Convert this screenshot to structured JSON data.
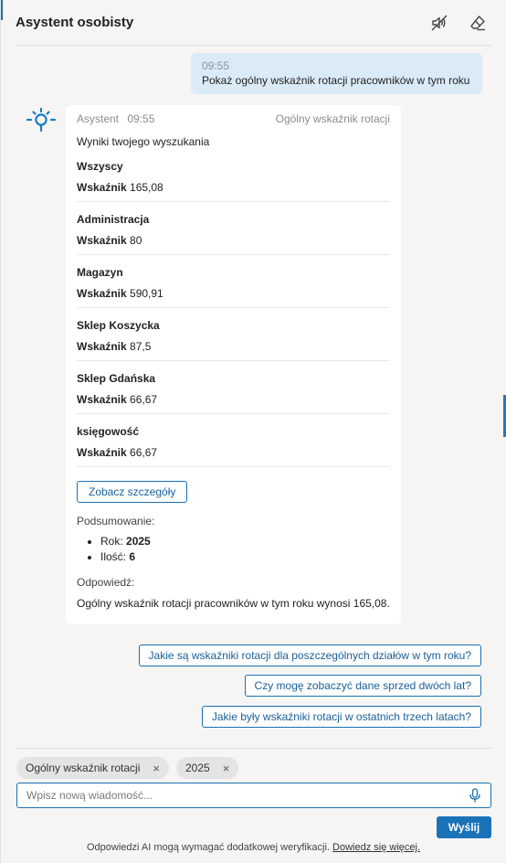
{
  "header": {
    "title": "Asystent osobisty",
    "icons": [
      "speaker-muted-icon",
      "eraser-icon"
    ]
  },
  "user_message": {
    "time": "09:55",
    "text": "Pokaż ogólny wskaźnik rotacji pracowników w tym roku"
  },
  "bot_message": {
    "author": "Asystent",
    "time": "09:55",
    "topic": "Ogólny wskaźnik rotacji",
    "results_label": "Wyniki twojego wyszukania",
    "value_label": "Wskaźnik",
    "departments": [
      {
        "name": "Wszyscy",
        "value": "165,08"
      },
      {
        "name": "Administracja",
        "value": "80"
      },
      {
        "name": "Magazyn",
        "value": "590,91"
      },
      {
        "name": "Sklep Koszycka",
        "value": "87,5"
      },
      {
        "name": "Sklep Gdańska",
        "value": "66,67"
      },
      {
        "name": "księgowość",
        "value": "66,67"
      }
    ],
    "details_button": "Zobacz szczegóły",
    "summary_label": "Podsumowanie:",
    "summary": [
      {
        "label": "Rok:",
        "value": "2025"
      },
      {
        "label": "Ilość:",
        "value": "6"
      }
    ],
    "answer_label": "Odpowiedź:",
    "answer_text": "Ogólny wskaźnik rotacji pracowników w tym roku wynosi 165,08."
  },
  "suggestions": [
    "Jakie są wskaźniki rotacji dla poszczególnych działów w tym roku?",
    "Czy mogę zobaczyć dane sprzed dwóch lat?",
    "Jakie były wskaźniki rotacji w ostatnich trzech latach?"
  ],
  "filters": [
    {
      "label": "Ogólny wskaźnik rotacji",
      "remove": "×"
    },
    {
      "label": "2025",
      "remove": "×"
    }
  ],
  "composer": {
    "placeholder": "Wpisz nową wiadomość...",
    "send_label": "Wyślij"
  },
  "disclaimer": {
    "text": "Odpowiedzi AI mogą wymagać dodatkowej weryfikacji.",
    "link": "Dowiedz się więcej."
  },
  "colors": {
    "accent": "#1a6fb0",
    "user_bubble": "#dbeaf7",
    "background": "#f6f5f4"
  }
}
